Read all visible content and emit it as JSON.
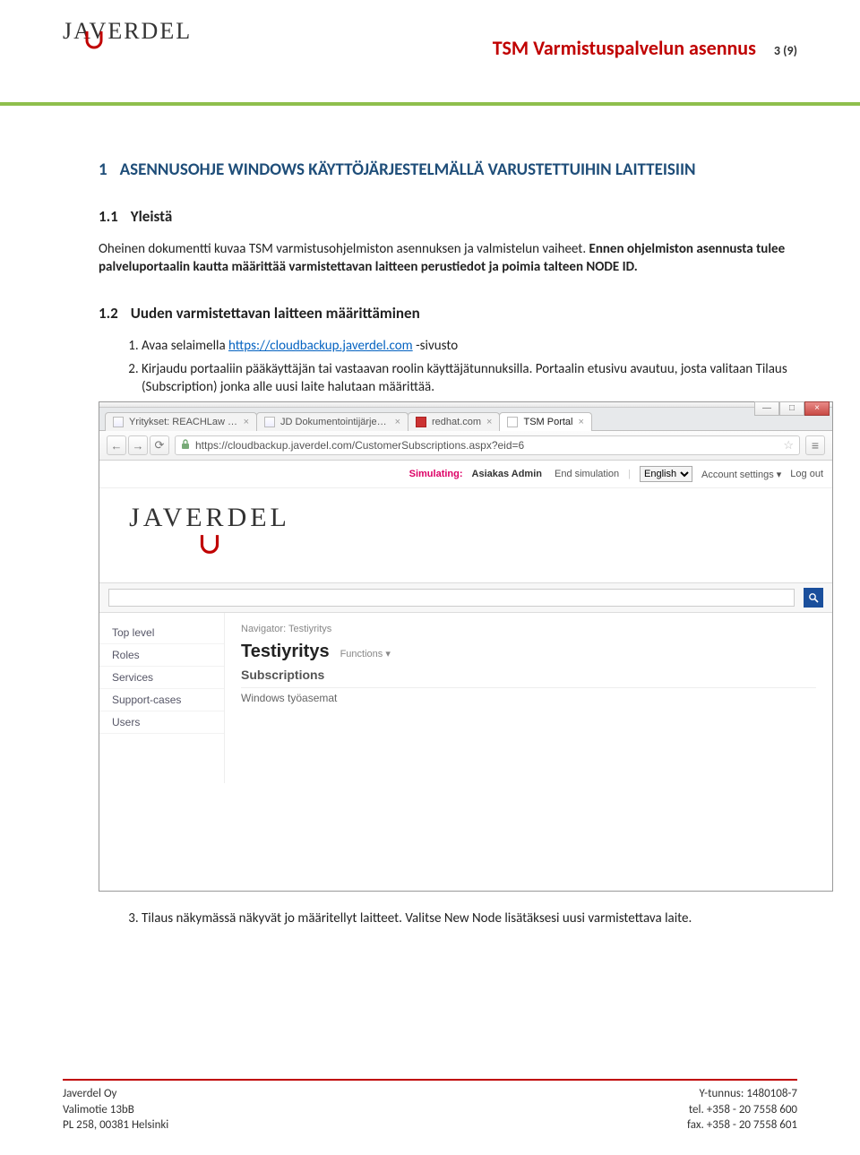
{
  "header": {
    "logo_text": "JAVERDEL",
    "doc_title": "TSM Varmistuspalvelun asennus",
    "page_indicator": "3 (9)"
  },
  "section1": {
    "num": "1",
    "title": "ASENNUSOHJE WINDOWS KÄYTTÖJÄRJESTELMÄLLÄ VARUSTETTUIHIN LAITTEISIIN"
  },
  "section1_1": {
    "num": "1.1",
    "title": "Yleistä",
    "para1": "Oheinen dokumentti kuvaa TSM varmistusohjelmiston asennuksen ja valmistelun vaiheet. ",
    "para1_bold": "Ennen ohjelmiston asennusta tulee palveluportaalin kautta määrittää varmistettavan laitteen perustiedot ja poimia talteen NODE ID."
  },
  "section1_2": {
    "num": "1.2",
    "title": "Uuden varmistettavan laitteen määrittäminen",
    "step1_pre": "Avaa selaimella ",
    "step1_link": "https://cloudbackup.javerdel.com",
    "step1_post": " -sivusto",
    "step2": "Kirjaudu portaaliin pääkäyttäjän tai vastaavan roolin käyttäjätunnuksilla. Portaalin etusivu avautuu, josta valitaan Tilaus (Subscription) jonka alle uusi laite halutaan määrittää.",
    "step3": "Tilaus näkymässä näkyvät jo määritellyt laitteet. Valitse New Node lisätäksesi uusi varmistettava laite."
  },
  "browser": {
    "win_min": "—",
    "win_max": "□",
    "win_close": "×",
    "tabs": [
      {
        "label": "Yritykset: REACHLaw Oy - ",
        "favclass": "doc"
      },
      {
        "label": "JD Dokumentointijärjeste",
        "favclass": "doc"
      },
      {
        "label": "redhat.com",
        "favclass": "rh"
      },
      {
        "label": "TSM Portal",
        "favclass": "file"
      }
    ],
    "nav_back": "←",
    "nav_fwd": "→",
    "nav_reload": "⟳",
    "url": "https://cloudbackup.javerdel.com/CustomerSubscriptions.aspx?eid=6",
    "star": "☆",
    "menu": "≡"
  },
  "portal": {
    "sim_label": "Simulating:",
    "sim_user": "Asiakas Admin",
    "sim_end": "End simulation",
    "lang_value": "English",
    "account_settings": "Account settings ▾",
    "logout": "Log out",
    "logo_text": "JAVERDEL",
    "sidebar": [
      "Top level",
      "Roles",
      "Services",
      "Support-cases",
      "Users"
    ],
    "nav_label": "Navigator:",
    "nav_value": "Testiyritys",
    "company": "Testiyritys",
    "functions": "Functions ▾",
    "subs_heading": "Subscriptions",
    "subs_item": "Windows työasemat"
  },
  "footer": {
    "left1": "Javerdel Oy",
    "left2": "Valimotie 13bB",
    "left3": "PL 258, 00381 Helsinki",
    "right1": "Y-tunnus: 1480108-7",
    "right2": "tel. +358 - 20 7558 600",
    "right3": "fax. +358 - 20 7558 601"
  }
}
